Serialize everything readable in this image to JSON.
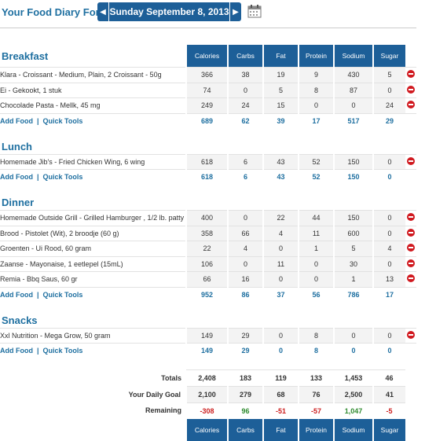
{
  "header": {
    "label": "Your Food Diary For:",
    "date": "Sunday September 8, 2013",
    "prev_icon": "chevron-left-icon",
    "next_icon": "chevron-right-icon",
    "calendar_icon": "calendar-icon"
  },
  "columns": [
    "Calories",
    "Carbs",
    "Fat",
    "Protein",
    "Sodium",
    "Sugar"
  ],
  "add_food": "Add Food",
  "quick_tools": "Quick Tools",
  "separator": "|",
  "meals": [
    {
      "name": "Breakfast",
      "items": [
        {
          "food": "Klara - Croissant - Medium, Plain, 2 Croissant - 50g",
          "values": [
            "366",
            "38",
            "19",
            "9",
            "430",
            "5"
          ]
        },
        {
          "food": "Ei - Gekookt, 1 stuk",
          "values": [
            "74",
            "0",
            "5",
            "8",
            "87",
            "0"
          ]
        },
        {
          "food": "Chocolade Pasta - Mellk, 45 mg",
          "values": [
            "249",
            "24",
            "15",
            "0",
            "0",
            "24"
          ]
        }
      ],
      "totals": [
        "689",
        "62",
        "39",
        "17",
        "517",
        "29"
      ]
    },
    {
      "name": "Lunch",
      "items": [
        {
          "food": "Homemade Jib's - Fried Chicken Wing, 6 wing",
          "values": [
            "618",
            "6",
            "43",
            "52",
            "150",
            "0"
          ]
        }
      ],
      "totals": [
        "618",
        "6",
        "43",
        "52",
        "150",
        "0"
      ]
    },
    {
      "name": "Dinner",
      "items": [
        {
          "food": "Homemade Outside Grill - Grilled Hamburger , 1/2 lb. patty",
          "values": [
            "400",
            "0",
            "22",
            "44",
            "150",
            "0"
          ]
        },
        {
          "food": "Brood - Pistolet (Wit), 2 broodje (60 g)",
          "values": [
            "358",
            "66",
            "4",
            "11",
            "600",
            "0"
          ]
        },
        {
          "food": "Groenten - Ui Rood, 60 gram",
          "values": [
            "22",
            "4",
            "0",
            "1",
            "5",
            "4"
          ]
        },
        {
          "food": "Zaanse - Mayonaise, 1 eetlepel (15mL)",
          "values": [
            "106",
            "0",
            "11",
            "0",
            "30",
            "0"
          ]
        },
        {
          "food": "Remia - Bbq Saus, 60 gr",
          "values": [
            "66",
            "16",
            "0",
            "0",
            "1",
            "13"
          ]
        }
      ],
      "totals": [
        "952",
        "86",
        "37",
        "56",
        "786",
        "17"
      ]
    },
    {
      "name": "Snacks",
      "items": [
        {
          "food": "Xxl Nutrition - Mega Grow, 50 gram",
          "values": [
            "149",
            "29",
            "0",
            "8",
            "0",
            "0"
          ]
        }
      ],
      "totals": [
        "149",
        "29",
        "0",
        "8",
        "0",
        "0"
      ]
    }
  ],
  "summary": {
    "totals": {
      "label": "Totals",
      "values": [
        "2,408",
        "183",
        "119",
        "133",
        "1,453",
        "46"
      ]
    },
    "goal": {
      "label": "Your Daily Goal",
      "values": [
        "2,100",
        "279",
        "68",
        "76",
        "2,500",
        "41"
      ]
    },
    "remaining": {
      "label": "Remaining",
      "values": [
        "-308",
        "96",
        "-51",
        "-57",
        "1,047",
        "-5"
      ],
      "status": [
        "neg",
        "pos",
        "neg",
        "neg",
        "pos",
        "neg"
      ]
    }
  },
  "colors": {
    "accent": "#1d5f98",
    "link": "#1e6fa0",
    "negative": "#cc1f1f",
    "positive": "#2d8a2d",
    "delete": "#d0191f"
  }
}
